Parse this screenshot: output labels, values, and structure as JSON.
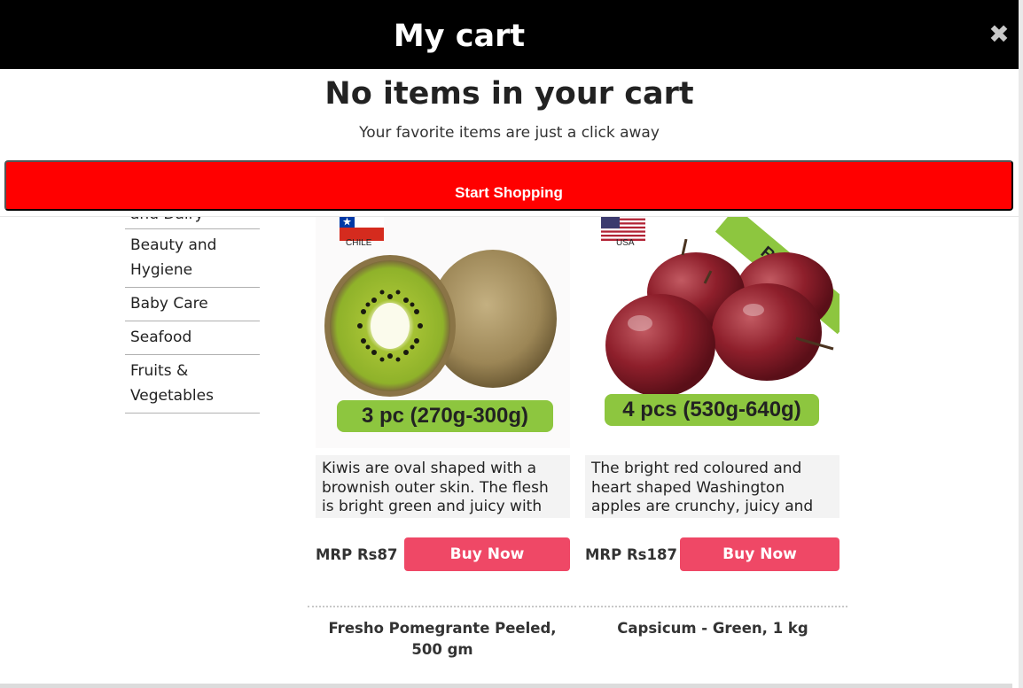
{
  "cart": {
    "title": "My cart",
    "empty_title": "No items in your cart",
    "empty_subtitle": "Your favorite items are just a click away",
    "start_button": "Start Shopping",
    "close_icon": "close-icon"
  },
  "sidebar": {
    "items": [
      {
        "label": "and Dairy"
      },
      {
        "label": "Beauty and Hygiene"
      },
      {
        "label": "Baby Care"
      },
      {
        "label": "Seafood"
      },
      {
        "label": "Fruits & Vegetables"
      }
    ]
  },
  "products": [
    {
      "flag_label": "CHILE",
      "quantity": "3 pc (270g-300g)",
      "description": "Kiwis are oval shaped with a brownish outer skin. The flesh is bright green and juicy with tiny,",
      "price": "MRP Rs87",
      "buy_label": "Buy Now"
    },
    {
      "flag_label": "USA",
      "quantity": "4 pcs (530g-640g)",
      "badge": "Regular",
      "description": "The bright red coloured and heart shaped Washington apples are crunchy, juicy and",
      "price": "MRP Rs187",
      "buy_label": "Buy Now"
    }
  ],
  "next_products": [
    {
      "name": "Fresho Pomegrante Peeled, 500 gm"
    },
    {
      "name": "Capsicum - Green, 1 kg"
    }
  ],
  "colors": {
    "header_bg": "#000000",
    "start_button": "#ff0000",
    "buy_button": "#ef4866",
    "quantity_pill": "#8dc63f"
  }
}
